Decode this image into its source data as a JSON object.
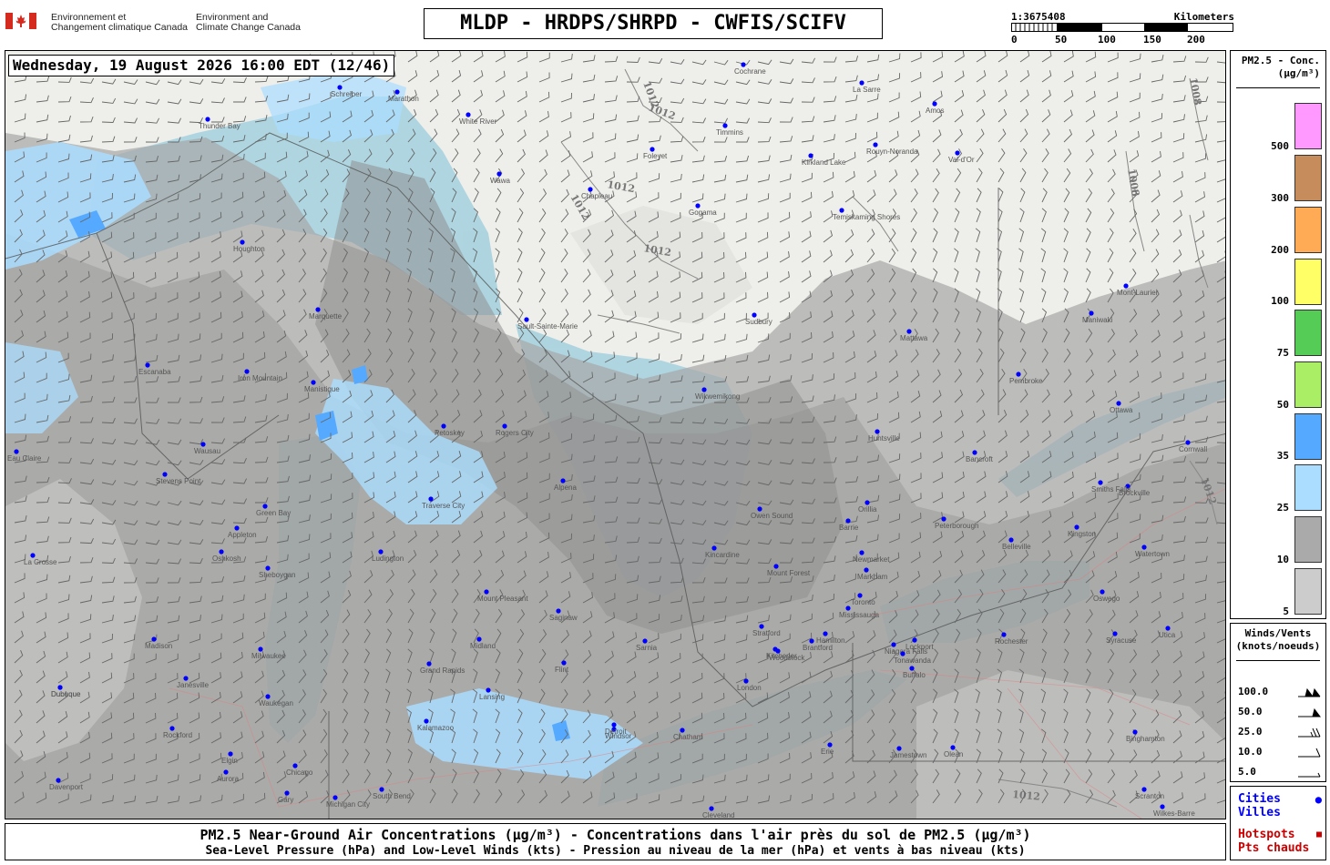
{
  "header": {
    "gov_fr": [
      "Environnement et",
      "Changement climatique Canada"
    ],
    "gov_en": [
      "Environment and",
      "Climate Change Canada"
    ],
    "title": "MLDP - HRDPS/SHRPD - CWFIS/SCIFV",
    "scale_ratio": "1:3675408",
    "scale_units": "Kilometers",
    "scale_ticks": [
      "0",
      "50",
      "100",
      "150",
      "200"
    ]
  },
  "map": {
    "datetime": "Wednesday, 19 August 2026 16:00 EDT (12/46)",
    "isobar_labels": [
      "1012",
      "1012",
      "1012",
      "1012",
      "1012",
      "1008",
      "1008",
      "1012",
      "1012"
    ],
    "cities": [
      "Thunder Bay",
      "Schreiber",
      "Marathon",
      "White River",
      "Wawa",
      "Chapleau",
      "Foleyet",
      "Timmins",
      "Cochrane",
      "Kirkland Lake",
      "Rouyn-Noranda",
      "La Sarre",
      "Amos",
      "Val-d'Or",
      "Temiskaming Shores",
      "Gogama",
      "Sault-Sainte-Marie",
      "Sudbury",
      "Mattawa",
      "Pembroke",
      "Ottawa",
      "Cornwall",
      "Maniwaki",
      "Mont-Laurier",
      "Marquette",
      "Houghton",
      "Wikwemikong",
      "Owen Sound",
      "Barrie",
      "Orillia",
      "Peterborough",
      "Belleville",
      "Kingston",
      "Brockville",
      "Toronto",
      "Mississauga",
      "Hamilton",
      "Niagara Falls",
      "Buffalo",
      "Rochester",
      "London",
      "Kitchener",
      "Stratford",
      "Woodstock",
      "Windsor",
      "Detroit",
      "Chatham",
      "Erie",
      "Cleveland",
      "Flint",
      "Lansing",
      "Grand Rapids",
      "Kalamazoo",
      "Milwaukee",
      "Chicago",
      "Green Bay",
      "Appleton",
      "Oshkosh",
      "Madison",
      "Rockford",
      "Dubuque",
      "Traverse City",
      "Alpena",
      "Saginaw",
      "Sarnia",
      "Syracuse",
      "Utica",
      "Oswego",
      "Watertown",
      "Binghamton",
      "Scranton",
      "Wilkes-Barre",
      "Jamestown",
      "Olean",
      "Smiths Falls",
      "Bancroft",
      "Huntsville",
      "Newmarket",
      "Markham",
      "Brantford",
      "Tonawanda",
      "Lockport",
      "Mount Forest",
      "Kincardine",
      "Mount Pleasant",
      "Midland",
      "Ludington",
      "Sheboygan",
      "Waukegan",
      "Janesville",
      "Aurora",
      "Elgin",
      "Gary",
      "South Bend",
      "Michigan City",
      "Petoskey",
      "Iron Mountain",
      "Escanaba",
      "Manistique",
      "Rogers City",
      "Stevens Point",
      "Wausau",
      "Eau Claire",
      "La Crosse",
      "Dubuque",
      "Davenport"
    ]
  },
  "legend_pm": {
    "title_1": "PM2.5 - Conc.",
    "title_2": "(μg/m³)",
    "bins": [
      {
        "label": "500",
        "color": "#ff99ff"
      },
      {
        "label": "300",
        "color": "#c68c5c"
      },
      {
        "label": "200",
        "color": "#ffaa55"
      },
      {
        "label": "100",
        "color": "#ffff66"
      },
      {
        "label": "75",
        "color": "#55cc55"
      },
      {
        "label": "50",
        "color": "#aaee66"
      },
      {
        "label": "35",
        "color": "#55aaff"
      },
      {
        "label": "25",
        "color": "#aaddff"
      },
      {
        "label": "10",
        "color": "#aaaaaa"
      },
      {
        "label": "5",
        "color": "#cccccc"
      }
    ]
  },
  "legend_wind": {
    "title_1": "Winds/Vents",
    "title_2": "(knots/noeuds)",
    "rows": [
      "100.0",
      "50.0",
      "25.0",
      "10.0",
      "5.0"
    ]
  },
  "legend_places": {
    "cities_en": "Cities",
    "cities_fr": "Villes",
    "hotspots_en": "Hotspots",
    "hotspots_fr": "Pts chauds",
    "city_color": "#0000ff",
    "hotspot_color": "#cc0000"
  },
  "footer": {
    "line1": "PM2.5 Near-Ground Air Concentrations (μg/m³) - Concentrations dans l'air près du sol de PM2.5 (μg/m³)",
    "line2": "Sea-Level Pressure (hPa) and Low-Level Winds (kts) - Pression au niveau de la mer (hPa) et vents à bas niveau (kts)"
  }
}
